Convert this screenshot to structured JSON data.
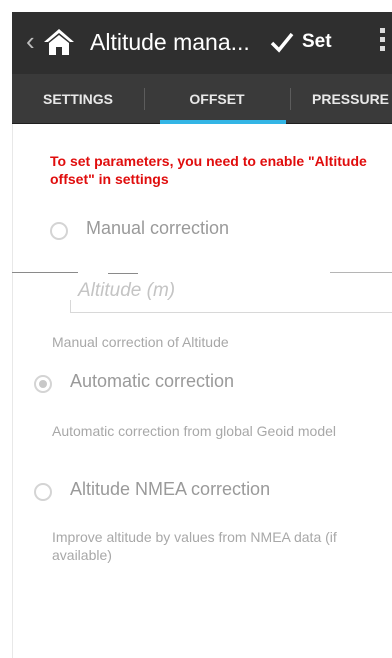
{
  "actionbar": {
    "title": "Altitude mana...",
    "set_label": "Set"
  },
  "tabs": [
    {
      "label": "SETTINGS"
    },
    {
      "label": "OFFSET",
      "selected": true
    },
    {
      "label": "PRESSURE"
    }
  ],
  "warning": "To set parameters, you need to enable \"Altitude offset\" in settings",
  "options": {
    "manual": {
      "label": "Manual correction",
      "input_placeholder": "Altitude (m)",
      "hint": "Manual correction of Altitude",
      "checked": false
    },
    "automatic": {
      "label": "Automatic correction",
      "hint": "Automatic correction from global Geoid model",
      "checked": true
    },
    "nmea": {
      "label": "Altitude NMEA correction",
      "hint": "Improve altitude by values from NMEA data (if available)",
      "checked": false
    }
  },
  "colors": {
    "accent": "#33b5e5",
    "warning": "#e00d0d",
    "actionbar_bg": "#2f2f2f",
    "tabbar_bg": "#3a3a3a"
  }
}
